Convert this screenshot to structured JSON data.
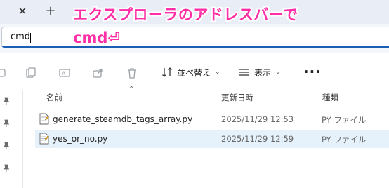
{
  "tabstrip": {
    "close_glyph": "✕",
    "new_tab_glyph": "+"
  },
  "annotation": {
    "line1": "エクスプローラのアドレスバーで",
    "line2": "cmd⏎",
    "color": "#ff2ea7"
  },
  "address_bar": {
    "value": "cmd"
  },
  "toolbar": {
    "sort_label": "並べ替え",
    "view_label": "表示",
    "more_glyph": "···"
  },
  "file_list": {
    "columns": {
      "name": "名前",
      "modified": "更新日時",
      "type": "種類"
    },
    "rows": [
      {
        "name": "generate_steamdb_tags_array.py",
        "modified": "2025/11/29 12:53",
        "type": "PY ファイル"
      },
      {
        "name": "yes_or_no.py",
        "modified": "2025/11/29 12:59",
        "type": "PY ファイル"
      }
    ]
  },
  "colors": {
    "accent": "#1a5fb4",
    "selection": "#e5f1fb",
    "tabstrip": "#e9eef6"
  }
}
